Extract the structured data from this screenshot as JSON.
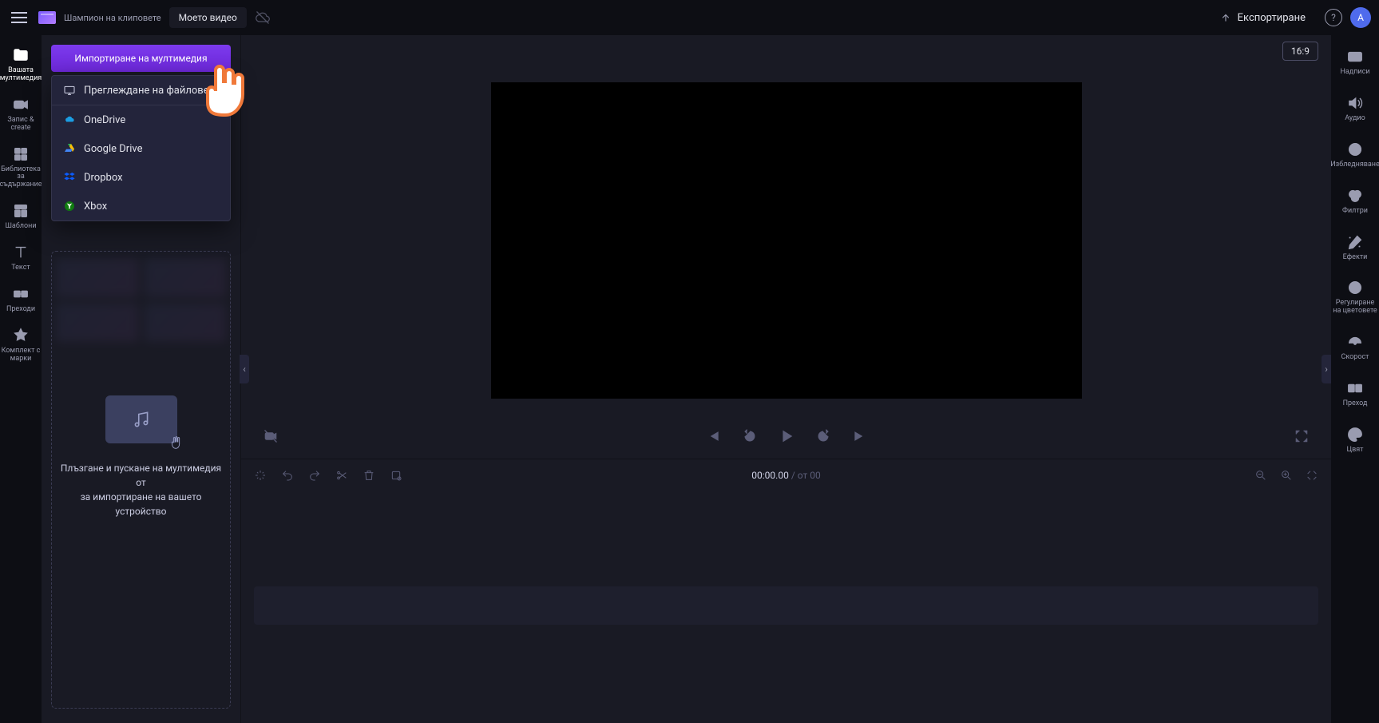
{
  "topbar": {
    "brand_label": "Шампион на клиповете",
    "project_name": "Моето видео",
    "export_label": "Експортиране",
    "avatar_letter": "A"
  },
  "left_rail": [
    {
      "label": "Вашата мултимедия",
      "name": "nav-your-media",
      "active": true
    },
    {
      "label": "Запис &amp; create",
      "name": "nav-record-create"
    },
    {
      "label": "Библиотека за съдържание",
      "name": "nav-content-library"
    },
    {
      "label": "Шаблони",
      "name": "nav-templates"
    },
    {
      "label": "Текст",
      "name": "nav-text"
    },
    {
      "label": "Преходи",
      "name": "nav-transitions"
    },
    {
      "label": "Комплект с марки",
      "name": "nav-brand-kit"
    }
  ],
  "media_panel": {
    "import_button": "Импортиране на мултимедия",
    "dropdown": {
      "browse": "Преглеждане на файлове",
      "onedrive": "OneDrive",
      "gdrive": "Google Drive",
      "dropbox": "Dropbox",
      "xbox": "Xbox"
    },
    "hint_line1": "Плъзгане и пускане на мултимедия от",
    "hint_line2": "за импортиране на вашето устройство"
  },
  "stage": {
    "aspect_ratio": "16:9"
  },
  "right_rail": [
    {
      "label": "Надписи",
      "name": "prop-captions"
    },
    {
      "label": "Аудио",
      "name": "prop-audio"
    },
    {
      "label": "Избледняване",
      "name": "prop-fade"
    },
    {
      "label": "Филтри",
      "name": "prop-filters"
    },
    {
      "label": "Ефекти",
      "name": "prop-effects"
    },
    {
      "label": "Регулиране на цветовете",
      "name": "prop-adjust-colors"
    },
    {
      "label": "Скорост",
      "name": "prop-speed"
    },
    {
      "label": "Преход",
      "name": "prop-transition"
    },
    {
      "label": "Цвят",
      "name": "prop-color"
    }
  ],
  "timeline": {
    "current_time": "00:00.00",
    "total_prefix": " / от ",
    "total_time": "00"
  },
  "colors": {
    "accent": "#7c3aed"
  }
}
